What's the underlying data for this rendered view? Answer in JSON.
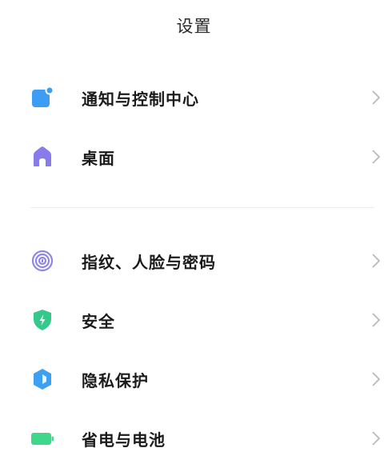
{
  "header": {
    "title": "设置"
  },
  "groups": [
    {
      "items": [
        {
          "label": "通知与控制中心",
          "icon": "notification-icon",
          "color": "#3d9df5"
        },
        {
          "label": "桌面",
          "icon": "home-icon",
          "color": "#8a7bea"
        }
      ]
    },
    {
      "items": [
        {
          "label": "指纹、人脸与密码",
          "icon": "fingerprint-icon",
          "color": "#8f87e6"
        },
        {
          "label": "安全",
          "icon": "shield-icon",
          "color": "#34c98b"
        },
        {
          "label": "隐私保护",
          "icon": "privacy-icon",
          "color": "#3da0f0"
        },
        {
          "label": "省电与电池",
          "icon": "battery-icon",
          "color": "#3fd88a"
        }
      ]
    }
  ]
}
